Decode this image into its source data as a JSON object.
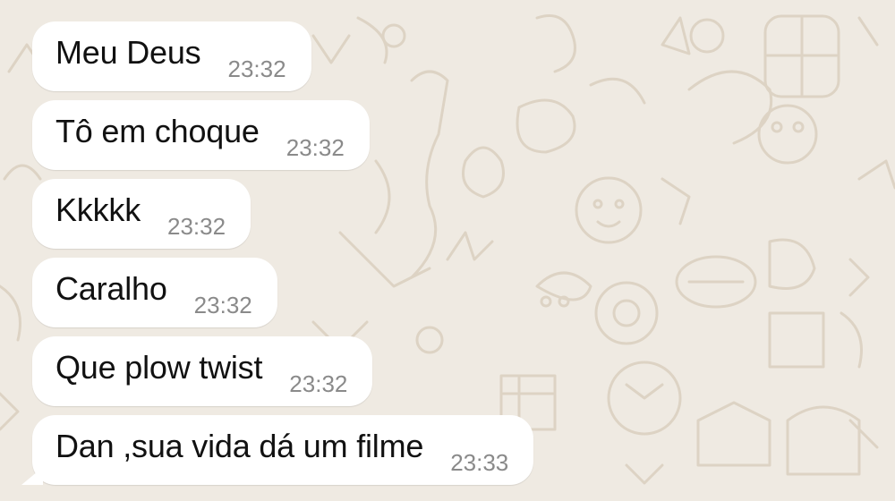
{
  "messages": [
    {
      "text": "Meu Deus",
      "time": "23:32"
    },
    {
      "text": "Tô em choque",
      "time": "23:32"
    },
    {
      "text": "Kkkkk",
      "time": "23:32"
    },
    {
      "text": "Caralho",
      "time": "23:32"
    },
    {
      "text": "Que plow twist",
      "time": "23:32"
    },
    {
      "text": "Dan ,sua vida dá um filme",
      "time": "23:33"
    }
  ],
  "colors": {
    "background": "#efeae2",
    "bubble": "#ffffff",
    "time_text": "#8a8a8a",
    "doodle": "#ddd3c4"
  }
}
